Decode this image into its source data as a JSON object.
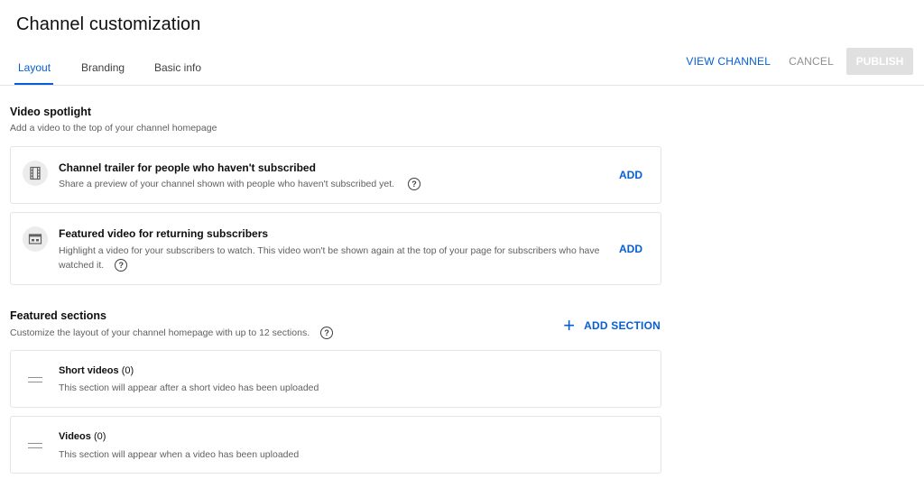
{
  "header": {
    "title": "Channel customization",
    "tabs": [
      {
        "label": "Layout",
        "active": true
      },
      {
        "label": "Branding",
        "active": false
      },
      {
        "label": "Basic info",
        "active": false
      }
    ],
    "actions": {
      "view_channel": "VIEW CHANNEL",
      "cancel": "CANCEL",
      "publish": "PUBLISH"
    }
  },
  "video_spotlight": {
    "title": "Video spotlight",
    "subtitle": "Add a video to the top of your channel homepage",
    "cards": [
      {
        "icon": "trailer-icon",
        "title": "Channel trailer for people who haven't subscribed",
        "description": "Share a preview of your channel shown with people who haven't subscribed yet.",
        "action": "ADD"
      },
      {
        "icon": "featured-video-icon",
        "title": "Featured video for returning subscribers",
        "description_line1": "Highlight a video for your subscribers to watch. This video won't be shown again at the top of your page for subscribers who have",
        "description_line2": "watched it.",
        "action": "ADD"
      }
    ]
  },
  "featured_sections": {
    "title": "Featured sections",
    "subtitle": "Customize the layout of your channel homepage with up to 12 sections.",
    "add_section": "ADD SECTION",
    "sections": [
      {
        "title": "Short videos",
        "count": "(0)",
        "description": "This section will appear after a short video has been uploaded"
      },
      {
        "title": "Videos",
        "count": "(0)",
        "description": "This section will appear when a video has been uploaded"
      }
    ]
  },
  "help_glyph": "?",
  "colors": {
    "accent": "#065fd4",
    "muted": "#606060",
    "disabled_button": "#e0e0e0",
    "border": "#e5e5e5"
  }
}
